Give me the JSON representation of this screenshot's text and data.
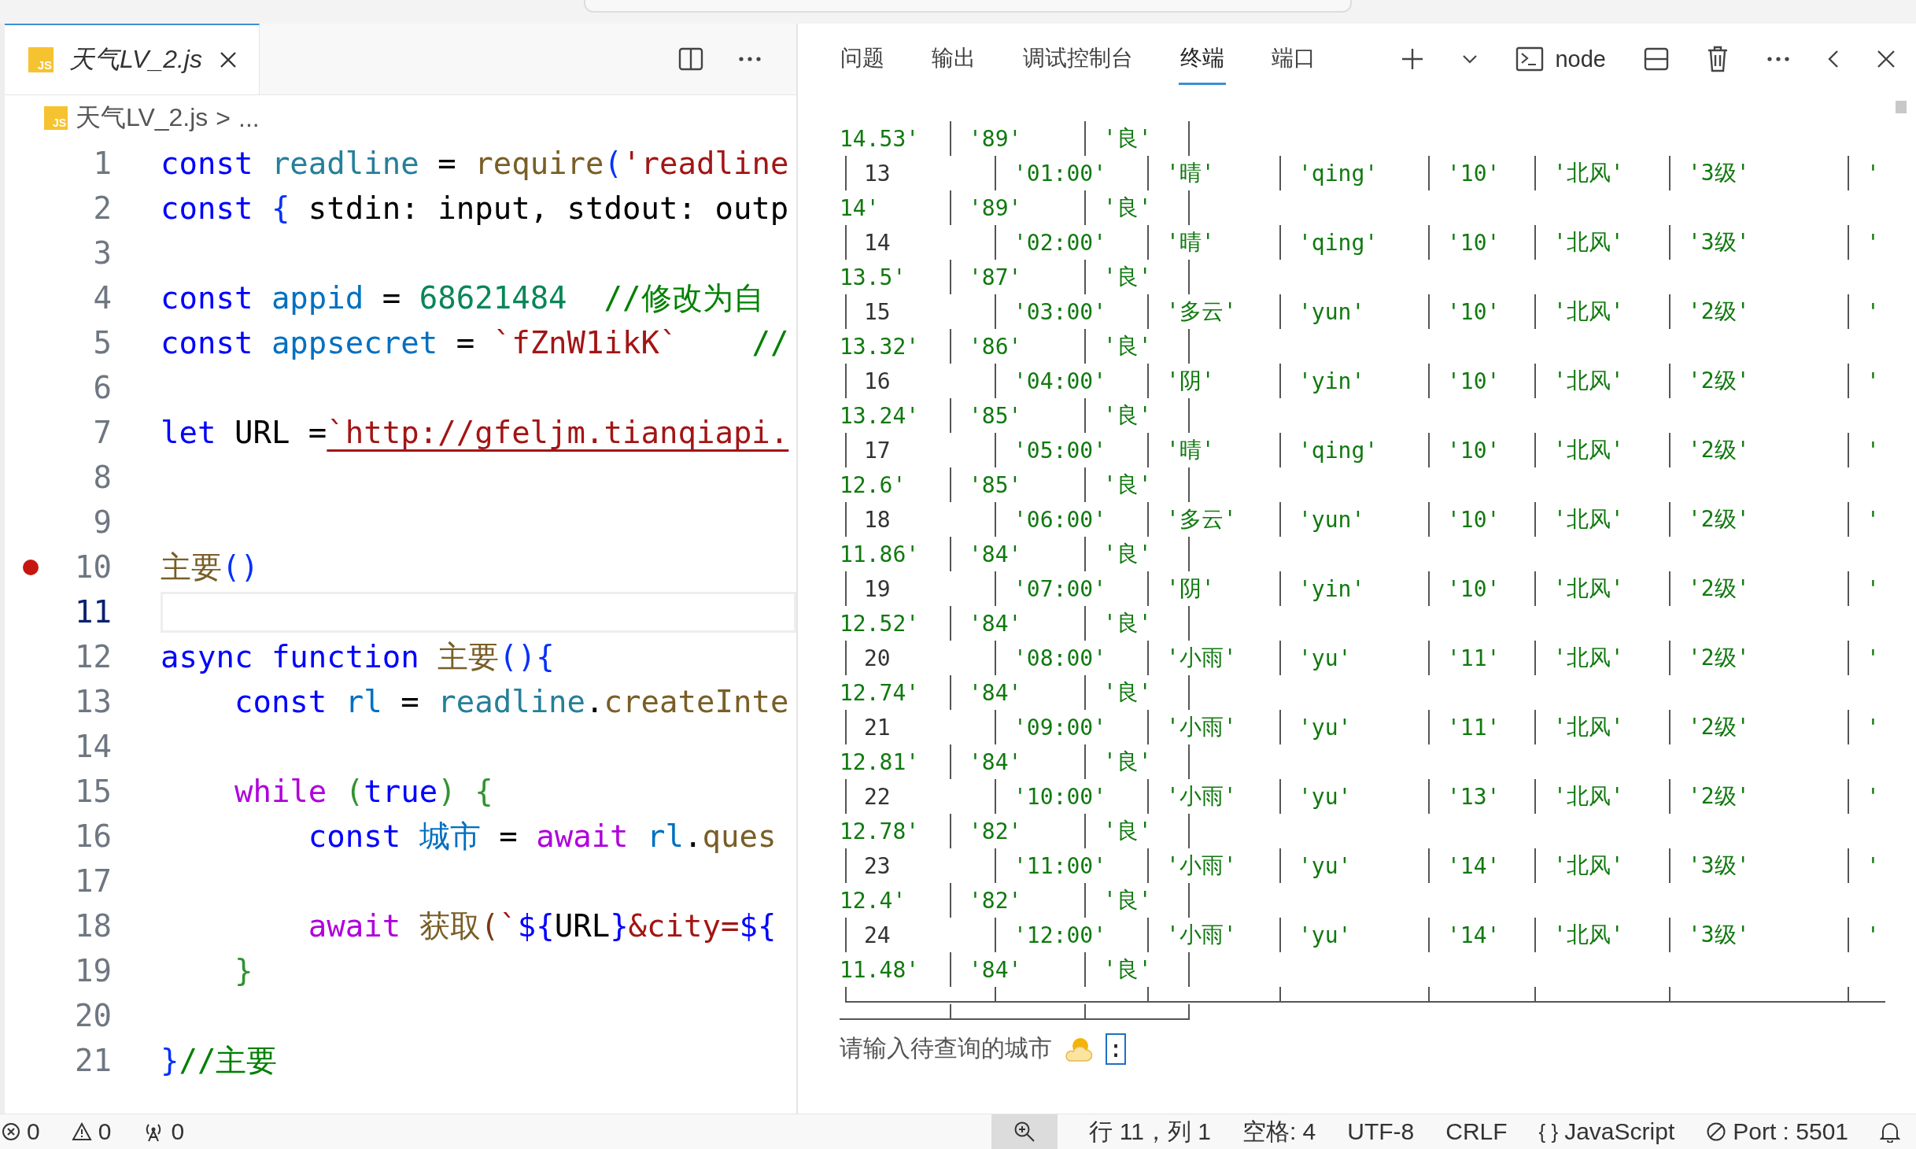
{
  "editor": {
    "tab": {
      "icon_text": "JS",
      "title": "天气LV_2.js",
      "selected": true
    },
    "breadcrumb": {
      "icon_text": "JS",
      "file": "天气LV_2.js",
      "separator": ">",
      "rest": "..."
    },
    "lines": [
      {
        "number": "1",
        "breakpoint": false,
        "current": false,
        "tokens": [
          {
            "kind": "kw",
            "text": "const "
          },
          {
            "kind": "ns",
            "text": "readline"
          },
          {
            "kind": "p",
            "text": " = "
          },
          {
            "kind": "fn",
            "text": "require"
          },
          {
            "kind": "b1",
            "text": "("
          },
          {
            "kind": "str",
            "text": "'readline"
          }
        ]
      },
      {
        "number": "2",
        "breakpoint": false,
        "current": false,
        "tokens": [
          {
            "kind": "kw",
            "text": "const "
          },
          {
            "kind": "b1",
            "text": "{"
          },
          {
            "kind": "p",
            "text": " stdin: input, stdout: outp"
          }
        ]
      },
      {
        "number": "3",
        "breakpoint": false,
        "current": false
      },
      {
        "number": "4",
        "breakpoint": false,
        "current": false,
        "tokens": [
          {
            "kind": "kw",
            "text": "const "
          },
          {
            "kind": "var",
            "text": "appid"
          },
          {
            "kind": "p",
            "text": " = "
          },
          {
            "kind": "num",
            "text": "68621484"
          },
          {
            "kind": "com",
            "text": "  //修改为自"
          }
        ]
      },
      {
        "number": "5",
        "breakpoint": false,
        "current": false,
        "tokens": [
          {
            "kind": "kw",
            "text": "const "
          },
          {
            "kind": "var",
            "text": "appsecret"
          },
          {
            "kind": "p",
            "text": " = "
          },
          {
            "kind": "str",
            "text": "`fZnW1ikK`"
          },
          {
            "kind": "com",
            "text": "    //"
          }
        ]
      },
      {
        "number": "6",
        "breakpoint": false,
        "current": false
      },
      {
        "number": "7",
        "breakpoint": false,
        "current": false,
        "tokens": [
          {
            "kind": "kw",
            "text": "let "
          },
          {
            "kind": "p",
            "text": "URL ="
          },
          {
            "kind": "link",
            "text": "`http://gfeljm.tianqiapi."
          }
        ]
      },
      {
        "number": "8",
        "breakpoint": false,
        "current": false
      },
      {
        "number": "9",
        "breakpoint": false,
        "current": false
      },
      {
        "number": "10",
        "breakpoint": true,
        "current": false,
        "tokens": [
          {
            "kind": "fn",
            "text": "主要"
          },
          {
            "kind": "b1",
            "text": "()"
          }
        ]
      },
      {
        "number": "11",
        "breakpoint": false,
        "current": true
      },
      {
        "number": "12",
        "breakpoint": false,
        "current": false,
        "tokens": [
          {
            "kind": "kw",
            "text": "async function "
          },
          {
            "kind": "fn",
            "text": "主要"
          },
          {
            "kind": "b1",
            "text": "(){"
          }
        ]
      },
      {
        "number": "13",
        "breakpoint": false,
        "current": false,
        "tokens": [
          {
            "kind": "kw",
            "text": "    const "
          },
          {
            "kind": "var",
            "text": "rl"
          },
          {
            "kind": "p",
            "text": " = "
          },
          {
            "kind": "ns",
            "text": "readline"
          },
          {
            "kind": "p",
            "text": "."
          },
          {
            "kind": "fn",
            "text": "createInte"
          }
        ]
      },
      {
        "number": "14",
        "breakpoint": false,
        "current": false
      },
      {
        "number": "15",
        "breakpoint": false,
        "current": false,
        "tokens": [
          {
            "kind": "ctl",
            "text": "    while "
          },
          {
            "kind": "b2",
            "text": "("
          },
          {
            "kind": "kw",
            "text": "true"
          },
          {
            "kind": "b2",
            "text": ") {"
          }
        ]
      },
      {
        "number": "16",
        "breakpoint": false,
        "current": false,
        "tokens": [
          {
            "kind": "kw",
            "text": "        const "
          },
          {
            "kind": "var",
            "text": "城市"
          },
          {
            "kind": "p",
            "text": " = "
          },
          {
            "kind": "ctl",
            "text": "await "
          },
          {
            "kind": "var",
            "text": "rl"
          },
          {
            "kind": "p",
            "text": "."
          },
          {
            "kind": "fn",
            "text": "ques"
          }
        ]
      },
      {
        "number": "17",
        "breakpoint": false,
        "current": false
      },
      {
        "number": "18",
        "breakpoint": false,
        "current": false,
        "tokens": [
          {
            "kind": "ctl",
            "text": "        await "
          },
          {
            "kind": "fn",
            "text": "获取"
          },
          {
            "kind": "b3",
            "text": "("
          },
          {
            "kind": "str",
            "text": "`"
          },
          {
            "kind": "kw",
            "text": "${"
          },
          {
            "kind": "p",
            "text": "URL"
          },
          {
            "kind": "kw",
            "text": "}"
          },
          {
            "kind": "str",
            "text": "&city="
          },
          {
            "kind": "kw",
            "text": "${"
          }
        ]
      },
      {
        "number": "19",
        "breakpoint": false,
        "current": false,
        "tokens": [
          {
            "kind": "b2",
            "text": "    }"
          }
        ]
      },
      {
        "number": "20",
        "breakpoint": false,
        "current": false
      },
      {
        "number": "21",
        "breakpoint": false,
        "current": false,
        "tokens": [
          {
            "kind": "b1",
            "text": "}"
          },
          {
            "kind": "com",
            "text": "//主要"
          }
        ]
      }
    ]
  },
  "panel": {
    "tabs": [
      {
        "label": "问题",
        "selected": false
      },
      {
        "label": "输出",
        "selected": false
      },
      {
        "label": "调试控制台",
        "selected": false
      },
      {
        "label": "终端",
        "selected": true
      },
      {
        "label": "端口",
        "selected": false
      }
    ],
    "terminal_name": "node",
    "lines": [
      {
        "kind": "cont",
        "cells": [
          "14.53'",
          "'89'",
          "'良'"
        ]
      },
      {
        "kind": "main",
        "cells": [
          "13",
          "'01:00'",
          "'晴'",
          "'qing'",
          "'10'",
          "'北风'",
          "'3级'",
          "'"
        ]
      },
      {
        "kind": "cont",
        "cells": [
          "14'",
          "'89'",
          "'良'"
        ]
      },
      {
        "kind": "main",
        "cells": [
          "14",
          "'02:00'",
          "'晴'",
          "'qing'",
          "'10'",
          "'北风'",
          "'3级'",
          "'"
        ]
      },
      {
        "kind": "cont",
        "cells": [
          "13.5'",
          "'87'",
          "'良'"
        ]
      },
      {
        "kind": "main",
        "cells": [
          "15",
          "'03:00'",
          "'多云'",
          "'yun'",
          "'10'",
          "'北风'",
          "'2级'",
          "'"
        ]
      },
      {
        "kind": "cont",
        "cells": [
          "13.32'",
          "'86'",
          "'良'"
        ]
      },
      {
        "kind": "main",
        "cells": [
          "16",
          "'04:00'",
          "'阴'",
          "'yin'",
          "'10'",
          "'北风'",
          "'2级'",
          "'"
        ]
      },
      {
        "kind": "cont",
        "cells": [
          "13.24'",
          "'85'",
          "'良'"
        ]
      },
      {
        "kind": "main",
        "cells": [
          "17",
          "'05:00'",
          "'晴'",
          "'qing'",
          "'10'",
          "'北风'",
          "'2级'",
          "'"
        ]
      },
      {
        "kind": "cont",
        "cells": [
          "12.6'",
          "'85'",
          "'良'"
        ]
      },
      {
        "kind": "main",
        "cells": [
          "18",
          "'06:00'",
          "'多云'",
          "'yun'",
          "'10'",
          "'北风'",
          "'2级'",
          "'"
        ]
      },
      {
        "kind": "cont",
        "cells": [
          "11.86'",
          "'84'",
          "'良'"
        ]
      },
      {
        "kind": "main",
        "cells": [
          "19",
          "'07:00'",
          "'阴'",
          "'yin'",
          "'10'",
          "'北风'",
          "'2级'",
          "'"
        ]
      },
      {
        "kind": "cont",
        "cells": [
          "12.52'",
          "'84'",
          "'良'"
        ]
      },
      {
        "kind": "main",
        "cells": [
          "20",
          "'08:00'",
          "'小雨'",
          "'yu'",
          "'11'",
          "'北风'",
          "'2级'",
          "'"
        ]
      },
      {
        "kind": "cont",
        "cells": [
          "12.74'",
          "'84'",
          "'良'"
        ]
      },
      {
        "kind": "main",
        "cells": [
          "21",
          "'09:00'",
          "'小雨'",
          "'yu'",
          "'11'",
          "'北风'",
          "'2级'",
          "'"
        ]
      },
      {
        "kind": "cont",
        "cells": [
          "12.81'",
          "'84'",
          "'良'"
        ]
      },
      {
        "kind": "main",
        "cells": [
          "22",
          "'10:00'",
          "'小雨'",
          "'yu'",
          "'13'",
          "'北风'",
          "'2级'",
          "'"
        ]
      },
      {
        "kind": "cont",
        "cells": [
          "12.78'",
          "'82'",
          "'良'"
        ]
      },
      {
        "kind": "main",
        "cells": [
          "23",
          "'11:00'",
          "'小雨'",
          "'yu'",
          "'14'",
          "'北风'",
          "'3级'",
          "'"
        ]
      },
      {
        "kind": "cont",
        "cells": [
          "12.4'",
          "'82'",
          "'良'"
        ]
      },
      {
        "kind": "main",
        "cells": [
          "24",
          "'12:00'",
          "'小雨'",
          "'yu'",
          "'14'",
          "'北风'",
          "'3级'",
          "'"
        ]
      },
      {
        "kind": "cont",
        "cells": [
          "11.48'",
          "'84'",
          "'良'"
        ]
      }
    ],
    "prompt": {
      "text": "请输入待查询的城市",
      "cursor_text": ":"
    }
  },
  "status_bar": {
    "left": [
      {
        "kind": "errors",
        "text": "0"
      },
      {
        "kind": "warnings",
        "text": "0"
      },
      {
        "kind": "ports",
        "text": "0"
      }
    ],
    "right": [
      {
        "kind": "zoom"
      },
      {
        "kind": "text",
        "text": "行 11，列 1"
      },
      {
        "kind": "text",
        "text": "空格: 4"
      },
      {
        "kind": "text",
        "text": "UTF-8"
      },
      {
        "kind": "text",
        "text": "CRLF"
      },
      {
        "kind": "language",
        "icon_text": "{ }",
        "text": "JavaScript"
      },
      {
        "kind": "port",
        "text": "Port : 5501"
      },
      {
        "kind": "bell"
      }
    ]
  }
}
